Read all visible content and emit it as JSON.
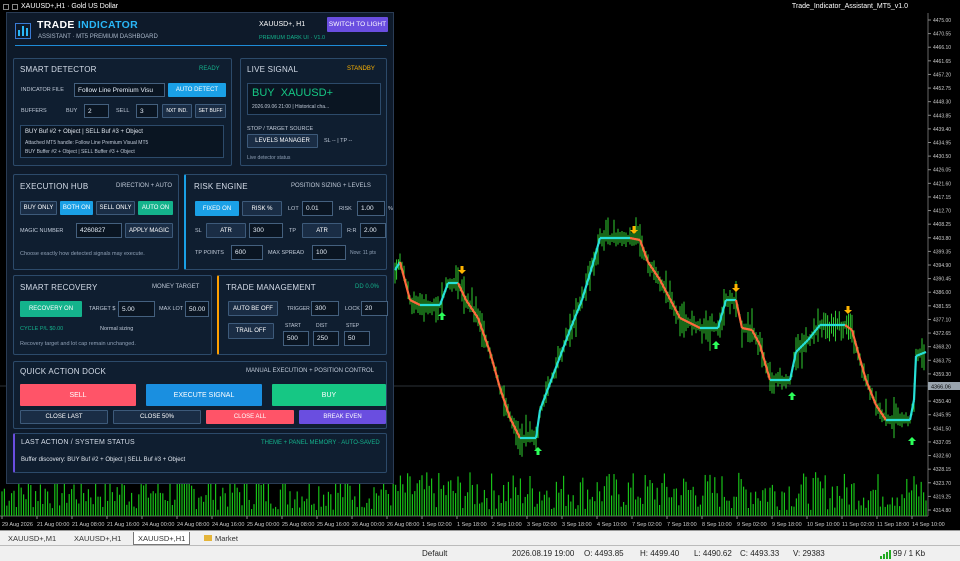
{
  "window": {
    "title": "XAUUSD+,H1 · Gold US Dollar",
    "right_title": "Trade_Indicator_Assistant_MT5_v1.0"
  },
  "axis": {
    "prices": [
      "4475.00",
      "4470.55",
      "4466.10",
      "4461.65",
      "4457.20",
      "4452.75",
      "4448.30",
      "4443.85",
      "4439.40",
      "4434.95",
      "4430.50",
      "4426.05",
      "4421.60",
      "4417.15",
      "4412.70",
      "4408.25",
      "4403.80",
      "4399.35",
      "4394.90",
      "4390.45",
      "4386.00",
      "4381.55",
      "4377.10",
      "4372.65",
      "4368.20",
      "4363.75",
      "4359.30",
      "4354.85",
      "4350.40",
      "4345.95",
      "4341.50",
      "4337.05",
      "4332.60",
      "4328.15",
      "4323.70",
      "4319.25",
      "4314.80"
    ],
    "current_price": "4366.06",
    "times": [
      "29 Aug 2026",
      "21 Aug 00:00",
      "21 Aug 08:00",
      "21 Aug 16:00",
      "24 Aug 00:00",
      "24 Aug 08:00",
      "24 Aug 16:00",
      "25 Aug 00:00",
      "25 Aug 08:00",
      "25 Aug 16:00",
      "26 Aug 00:00",
      "26 Aug 08:00",
      "1 Sep 02:00",
      "1 Sep 18:00",
      "2 Sep 10:00",
      "3 Sep 02:00",
      "3 Sep 18:00",
      "4 Sep 10:00",
      "7 Sep 02:00",
      "7 Sep 18:00",
      "8 Sep 10:00",
      "9 Sep 02:00",
      "9 Sep 18:00",
      "10 Sep 10:00",
      "11 Sep 02:00",
      "11 Sep 18:00",
      "14 Sep 10:00"
    ]
  },
  "panel": {
    "brand_a": "TRADE",
    "brand_b": "INDICATOR",
    "subtitle": "ASSISTANT · MT5 PREMIUM DASHBOARD",
    "symbol": "XAUUSD+, H1",
    "switch_label": "SWITCH TO LIGHT",
    "theme": "PREMIUM DARK UI · V1.0",
    "detector": {
      "title": "SMART DETECTOR",
      "status": "READY",
      "file_label": "INDICATOR FILE",
      "file_value": "Follow Line Premium Visu",
      "auto_detect": "AUTO DETECT",
      "buffers_label": "BUFFERS",
      "buy_label": "BUY",
      "buy_value": "2",
      "sell_label": "SELL",
      "sell_value": "3",
      "nxt": "NXT IND.",
      "set": "SET BUFF",
      "info1": "BUY Buf #2 + Object | SELL Buf #3 + Object",
      "info2": "Attached MT5 handle: Follow Line Premium Visual MT5",
      "info3": "BUY Buffer #2 + Object | SELL Buffer #3 + Object"
    },
    "signal": {
      "title": "LIVE SIGNAL",
      "status": "STANDBY",
      "buy": "BUY",
      "symbol": "XAUUSD+",
      "time": "2026.09.06 21:00 | Historical cha...",
      "stop_label": "STOP / TARGET SOURCE",
      "levels_btn": "LEVELS MANAGER",
      "sltp": "SL -- | TP --",
      "note": "Live detector status"
    },
    "exec": {
      "title": "EXECUTION HUB",
      "sub": "DIRECTION + AUTO",
      "buy_only": "BUY ONLY",
      "both_on": "BOTH ON",
      "sell_only": "SELL ONLY",
      "auto_on": "AUTO ON",
      "magic_label": "MAGIC NUMBER",
      "magic_value": "4260827",
      "apply": "APPLY MAGIC",
      "note": "Choose exactly how detected signals may execute."
    },
    "risk": {
      "title": "RISK ENGINE",
      "sub": "POSITION SIZING + LEVELS",
      "fixed": "FIXED ON",
      "riskp": "RISK %",
      "lot_label": "LOT",
      "lot_value": "0.01",
      "risk_label": "RISK",
      "risk_value": "1.00",
      "pct": "%",
      "sl_label": "SL",
      "sl_mode": "ATR",
      "sl_value": "300",
      "tp_label": "TP",
      "tp_mode": "ATR",
      "rr_label": "R:R",
      "rr_value": "2.00",
      "tpp_label": "TP POINTS",
      "tpp_value": "600",
      "spread_label": "MAX SPREAD",
      "spread_value": "100",
      "now": "Now: 11 pts"
    },
    "recovery": {
      "title": "SMART RECOVERY",
      "sub": "MONEY TARGET",
      "btn": "RECOVERY ON",
      "target_label": "TARGET $",
      "target_value": "5.00",
      "maxlot_label": "MAX LOT",
      "maxlot_value": "50.00",
      "cycle": "CYCLE P/L $0.00",
      "sizing": "Normal sizing",
      "note": "Recovery target and lot cap remain unchanged."
    },
    "trade": {
      "title": "TRADE MANAGEMENT",
      "status": "DD 0.0%",
      "be": "AUTO BE OFF",
      "trigger_label": "TRIGGER",
      "trigger_value": "300",
      "lock_label": "LOCK",
      "lock_value": "20",
      "trail": "TRAIL OFF",
      "start_label": "START",
      "start_value": "500",
      "dist_label": "DIST",
      "dist_value": "250",
      "step_label": "STEP",
      "step_value": "50"
    },
    "dock": {
      "title": "QUICK ACTION DOCK",
      "sub": "MANUAL EXECUTION + POSITION CONTROL",
      "sell": "SELL",
      "exec": "EXECUTE SIGNAL",
      "buy": "BUY",
      "close_last": "CLOSE LAST",
      "close50": "CLOSE 50%",
      "close_all": "CLOSE ALL",
      "breakeven": "BREAK EVEN"
    },
    "last": {
      "title": "LAST ACTION / SYSTEM STATUS",
      "sub": "THEME + PANEL MEMORY · AUTO-SAVED",
      "text": "Buffer discovery: BUY Buf #2 + Object | SELL Buf #3 + Object"
    }
  },
  "tabs": [
    "XAUUSD+,M1",
    "XAUUSD+,H1",
    "XAUUSD+,H1",
    "Market"
  ],
  "status": {
    "profile": "Default",
    "time": "2026.08.19 19:00",
    "o": "O: 4493.85",
    "h": "H: 4499.40",
    "l": "L: 4490.62",
    "c": "C: 4493.33",
    "v": "V: 29383",
    "net": "99 / 1 Kb"
  },
  "colors": {
    "bg": "#000000",
    "up": "#3dff3d",
    "line_up": "#27e0d8",
    "line_dn": "#ff6a3d",
    "arrow_up": "#2cff5a",
    "arrow_dn": "#ffb400",
    "sell": "#ff5468",
    "buy": "#16c784",
    "exec": "#1a8fe0"
  }
}
